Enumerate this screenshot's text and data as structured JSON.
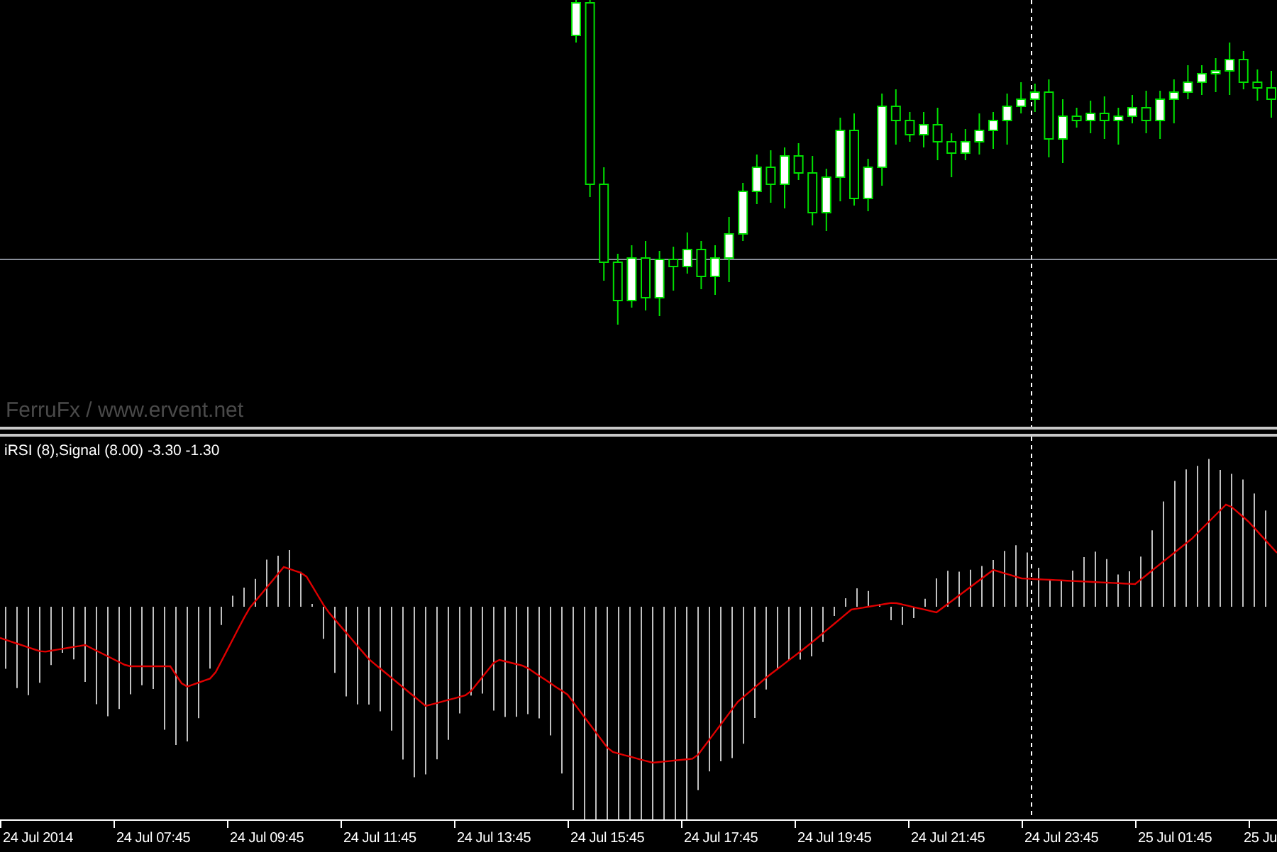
{
  "price_chart": {
    "caption": "FerruFx / www.ervent.net"
  },
  "indicator": {
    "label": "iRSI (8),Signal (8.00) -3.30 -1.30"
  },
  "time_axis": {
    "labels": [
      "24 Jul 2014",
      "24 Jul 07:45",
      "24 Jul 09:45",
      "24 Jul 11:45",
      "24 Jul 13:45",
      "24 Jul 15:45",
      "24 Jul 17:45",
      "24 Jul 19:45",
      "24 Jul 21:45",
      "24 Jul 23:45",
      "25 Jul 01:45",
      "25 Ju"
    ]
  }
}
